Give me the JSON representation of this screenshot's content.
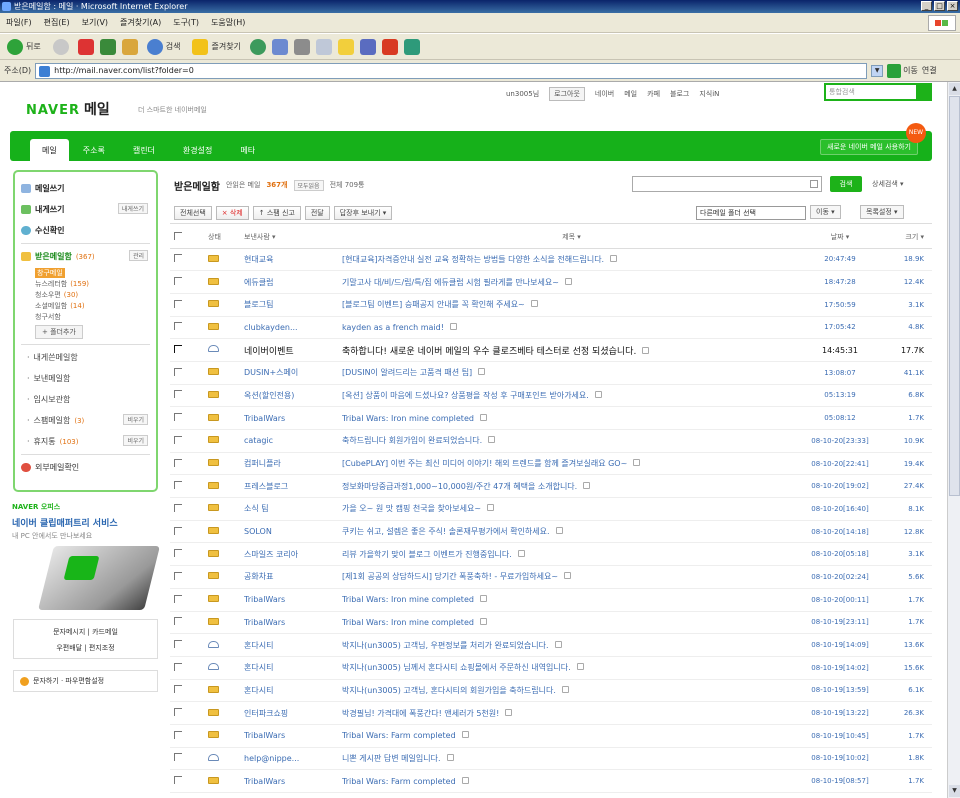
{
  "window": {
    "title": "받은메일함 : 메일 · Microsoft Internet Explorer",
    "controls": [
      "_",
      "□",
      "×"
    ]
  },
  "menu": [
    "파일(F)",
    "편집(E)",
    "보기(V)",
    "즐겨찾기(A)",
    "도구(T)",
    "도움말(H)"
  ],
  "toolbar": {
    "back": "뒤로",
    "search": "검색",
    "favorites": "즐겨찾기"
  },
  "address": {
    "label": "주소(D)",
    "url": "http://mail.naver.com/list?folder=0",
    "go": "이동",
    "links": "연결"
  },
  "header": {
    "logo": "NAVER",
    "logo_mail": "메일",
    "tagline": "더 스마트한 네이버메일",
    "user": "un3005님",
    "logout": "로그아웃",
    "nav": [
      "네이버",
      "메일",
      "카페",
      "블로그",
      "지식iN"
    ],
    "search_placeholder": "통합검색"
  },
  "tabs": [
    "메일",
    "주소록",
    "캘린더",
    "환경설정",
    "메타"
  ],
  "promo_banner": {
    "text": "새로운 네이버 메일 사용하기",
    "badge": "NEW"
  },
  "sidebar": {
    "write": "메일쓰기",
    "write_self": "내게쓰기",
    "write_self_btn": "내게쓰기",
    "receipt": "수신확인",
    "inbox": "받은메일함",
    "inbox_count": "(367)",
    "inbox_btn": "관리",
    "subfolders": [
      {
        "name": "창구메일",
        "count": ""
      },
      {
        "name": "뉴스레터함",
        "count": "(159)"
      },
      {
        "name": "청소우편",
        "count": "(30)"
      },
      {
        "name": "소셜메일함",
        "count": "(14)"
      },
      {
        "name": "청구서함",
        "count": ""
      }
    ],
    "add_folder": "+ 폴더추가",
    "folders": [
      {
        "name": "내게쓴메일함",
        "count": "",
        "btn": ""
      },
      {
        "name": "보낸메일함",
        "count": "",
        "btn": ""
      },
      {
        "name": "임시보관함",
        "count": "",
        "btn": ""
      },
      {
        "name": "스팸메일함",
        "count": "(3)",
        "btn": "비우기"
      },
      {
        "name": "휴지통",
        "count": "(103)",
        "btn": "비우기"
      }
    ],
    "external": "외부메일확인"
  },
  "side_promo": {
    "label": "NAVER 오피스",
    "title": "네이버 클립매퍼트리 서비스",
    "sub": "내 PC 안에서도 만나보세요"
  },
  "side_links": {
    "row1": "문자메시지 | 카드메일",
    "row2": "우편배달 | 편지조정",
    "bottom": "문자하기 · 파우편함설정"
  },
  "main": {
    "title": "받은메일함",
    "unread_label": "안읽은 메일",
    "unread_count": "367개",
    "all_read_btn": "모두읽음",
    "total": "전체 709통",
    "search_btn": "검색",
    "detail_search": "상세검색 ▾",
    "actions": [
      "전체선택",
      "× 삭제",
      "↑ 스팸 신고",
      "전달",
      "답장후 보내기 ▾"
    ],
    "move_select": "다른메일 폴더 선택",
    "move_btn": "이동 ▾",
    "list_settings": "목록설정 ▾",
    "columns": {
      "status": "상태",
      "from": "보낸사람 ▾",
      "subject": "제목 ▾",
      "date": "날짜 ▾",
      "size": "크기 ▾"
    },
    "rows": [
      {
        "read": false,
        "from": "현대교육",
        "subject": "[현대교육]자격증안내 실전 교육 정확하는 방법들 다양한 소식을 전해드립니다.",
        "date": "20:47:49",
        "size": "18.9K",
        "hi": false
      },
      {
        "read": false,
        "from": "에듀클럽",
        "subject": "기말고사 대/비/드/립/특/집 에듀클럽 시험 필라게를 만나보세요~",
        "date": "18:47:28",
        "size": "12.4K",
        "hi": false
      },
      {
        "read": false,
        "from": "블로그팀",
        "subject": "[블로그팀 이벤트] 승패공지 안내를 꼭 확인해 주세요~",
        "date": "17:50:59",
        "size": "3.1K",
        "hi": false
      },
      {
        "read": false,
        "from": "clubkayden...",
        "subject": "kayden as a french maid!",
        "date": "17:05:42",
        "size": "4.8K",
        "hi": false
      },
      {
        "read": true,
        "from": "네이버이벤트",
        "subject": "축하합니다! 새로운 네이버 메일의 우수 클로즈베타 테스터로 선정 되셨습니다.",
        "date": "14:45:31",
        "size": "17.7K",
        "hi": true
      },
      {
        "read": false,
        "from": "DUSIN+스페이",
        "subject": "[DUSIN이 알려드리는 고품격 패션 팁]",
        "date": "13:08:07",
        "size": "41.1K",
        "hi": false
      },
      {
        "read": false,
        "from": "옥션(할인전용)",
        "subject": "[옥션] 상품이 마음에 드셨나요? 상품평을 작성 후 구매포인트 받아가세요.",
        "date": "05:13:19",
        "size": "6.8K",
        "hi": false
      },
      {
        "read": false,
        "from": "TribalWars",
        "subject": "Tribal Wars: Iron mine completed",
        "date": "05:08:12",
        "size": "1.7K",
        "hi": false
      },
      {
        "read": false,
        "from": "catagic",
        "subject": "축하드립니다 회원가입이 완료되었습니다.",
        "date": "08-10-20[23:33]",
        "size": "10.9K",
        "hi": false
      },
      {
        "read": false,
        "from": "컴퍼니플라",
        "subject": "[CubePLAY] 이번 주는 최신 미디어 이야기! 해외 트렌드를 함께 즐겨보실래요 GO~",
        "date": "08-10-20[22:41]",
        "size": "19.4K",
        "hi": false
      },
      {
        "read": false,
        "from": "프레스블로그",
        "subject": "정보화마당중급과정1,000~10,000원/주간 47개 혜택을 소개합니다.",
        "date": "08-10-20[19:02]",
        "size": "27.4K",
        "hi": false
      },
      {
        "read": false,
        "from": "소식 팀",
        "subject": "가을 오~ 원 맛 캠핑 천국을 찾아보세요~",
        "date": "08-10-20[16:40]",
        "size": "8.1K",
        "hi": false
      },
      {
        "read": false,
        "from": "SOLON",
        "subject": "쿠키는 쉬고, 설렘은 좋은 주식! 솔론재무평가에서 확인하세요.",
        "date": "08-10-20[14:18]",
        "size": "12.8K",
        "hi": false
      },
      {
        "read": false,
        "from": "스마일즈 코리아",
        "subject": "리뷰 가을학기 맞이 블로그 이벤트가 진행중입니다.",
        "date": "08-10-20[05:18]",
        "size": "3.1K",
        "hi": false
      },
      {
        "read": false,
        "from": "공화차표",
        "subject": "[제1회 공공의 상담하드시] 당기간 폭풍축하! - 무료가입하세요~",
        "date": "08-10-20[02:24]",
        "size": "5.6K",
        "hi": false
      },
      {
        "read": false,
        "from": "TribalWars",
        "subject": "Tribal Wars: Iron mine completed",
        "date": "08-10-20[00:11]",
        "size": "1.7K",
        "hi": false
      },
      {
        "read": false,
        "from": "TribalWars",
        "subject": "Tribal Wars: Iron mine completed",
        "date": "08-10-19[23:11]",
        "size": "1.7K",
        "hi": false
      },
      {
        "read": true,
        "from": "혼다시티",
        "subject": "박지나(un3005) 고객님, 우편정보를 처리가 완료되었습니다.",
        "date": "08-10-19[14:09]",
        "size": "13.6K",
        "hi": false
      },
      {
        "read": true,
        "from": "혼다시티",
        "subject": "박지나(un3005) 님께서 혼다시티 쇼핑몰에서 주문하신 내역입니다.",
        "date": "08-10-19[14:02]",
        "size": "15.6K",
        "hi": false
      },
      {
        "read": false,
        "from": "혼다시티",
        "subject": "박지나(un3005) 고객님, 혼다시티의 회원가입을 축하드립니다.",
        "date": "08-10-19[13:59]",
        "size": "6.1K",
        "hi": false
      },
      {
        "read": false,
        "from": "인터파크쇼핑",
        "subject": "박경필님! 가격대에 폭풍간다! 앤세러가 5천원!",
        "date": "08-10-19[13:22]",
        "size": "26.3K",
        "hi": false
      },
      {
        "read": false,
        "from": "TribalWars",
        "subject": "Tribal Wars: Farm completed",
        "date": "08-10-19[10:45]",
        "size": "1.7K",
        "hi": false
      },
      {
        "read": true,
        "from": "help@nippe...",
        "subject": "니뽄 게시판 답변 메일입니다.",
        "date": "08-10-19[10:02]",
        "size": "1.8K",
        "hi": false
      },
      {
        "read": false,
        "from": "TribalWars",
        "subject": "Tribal Wars: Farm completed",
        "date": "08-10-19[08:57]",
        "size": "1.7K",
        "hi": false
      }
    ]
  },
  "colors": {
    "brand": "#1db219",
    "link": "#3b6cb3",
    "unread_count": "#e07010"
  }
}
